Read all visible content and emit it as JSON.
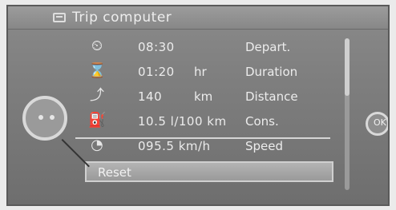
{
  "header": {
    "title": "Trip computer",
    "icon": "trip-computer-icon"
  },
  "rows": [
    {
      "icon": "clock-depart-icon",
      "value": "08:30",
      "unit": "",
      "label": "Depart."
    },
    {
      "icon": "hourglass-icon",
      "value": "01:20",
      "unit": "hr",
      "label": "Duration"
    },
    {
      "icon": "route-icon",
      "value": "140",
      "unit": "km",
      "label": "Distance"
    },
    {
      "icon": "fuel-pump-icon",
      "value": "10.5 l/100 km",
      "unit": "",
      "label": "Cons."
    },
    {
      "icon": "speedometer-icon",
      "value": "095.5 km/h",
      "unit": "",
      "label": "Speed"
    }
  ],
  "reset": {
    "label": "Reset"
  },
  "right_button": {
    "label": "OK"
  },
  "colors": {
    "panel": "#7f7f7f",
    "text": "#ececec",
    "highlight": "#b4b4b4"
  }
}
